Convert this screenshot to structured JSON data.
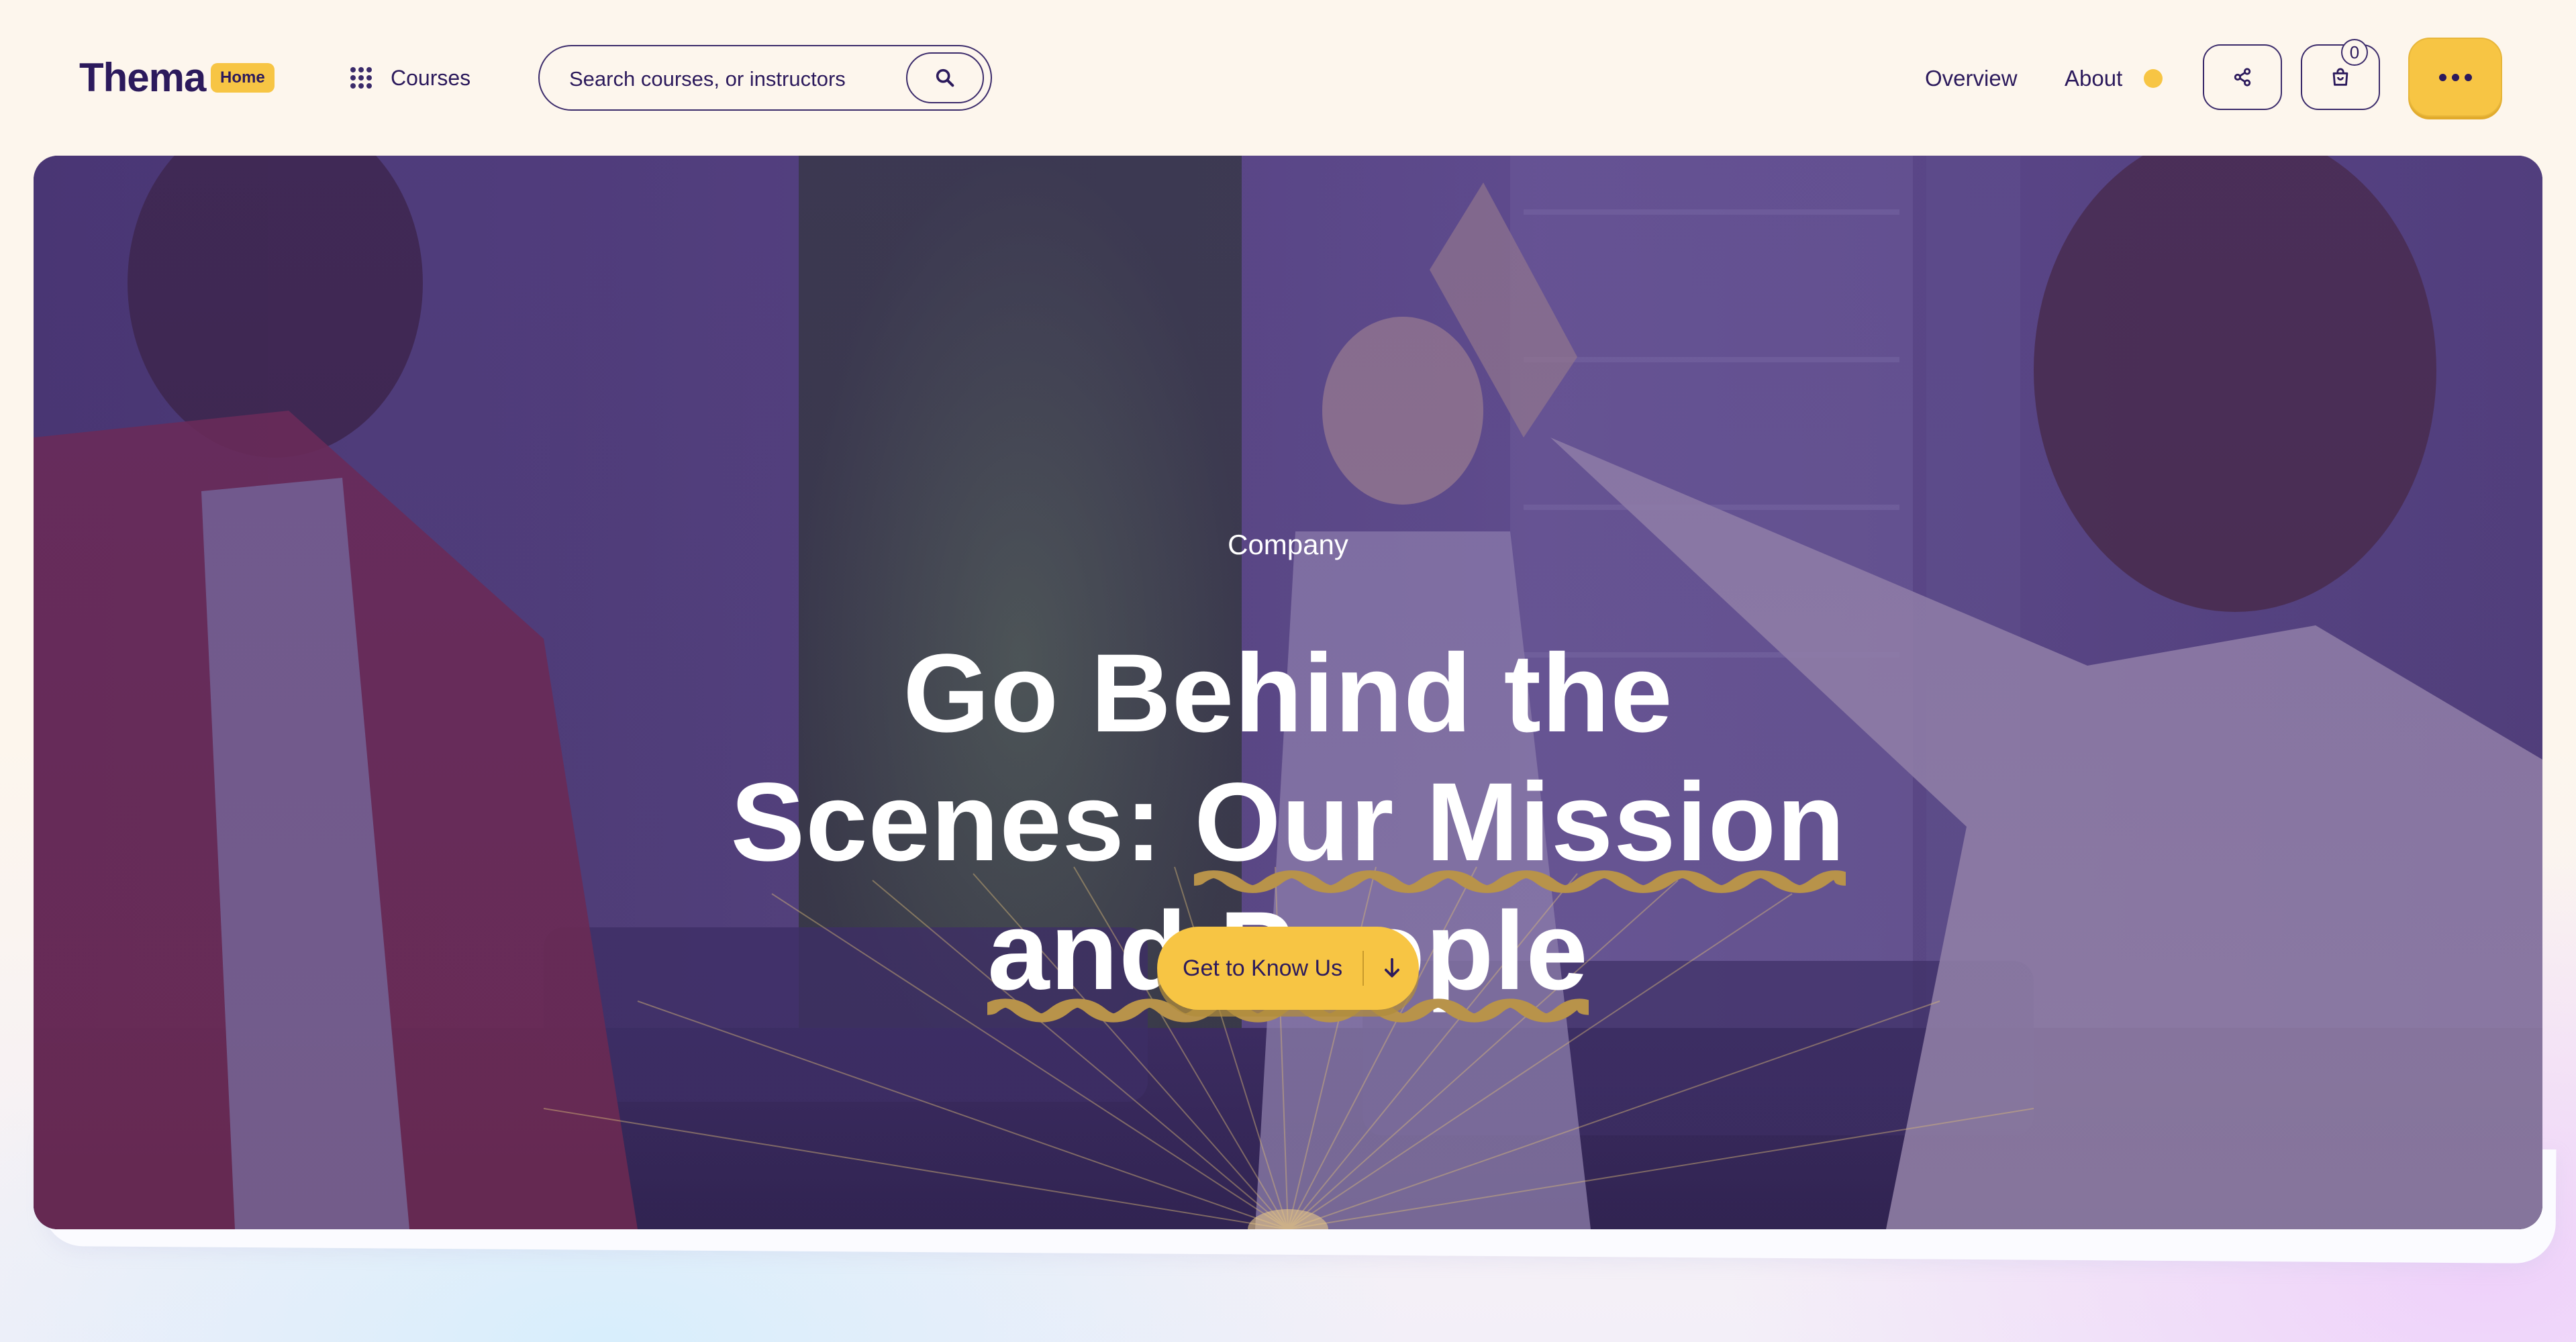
{
  "header": {
    "logo": "Thema",
    "home_badge": "Home",
    "courses_label": "Courses",
    "search": {
      "placeholder": "Search courses, or instructors",
      "value": ""
    },
    "nav": [
      {
        "label": "Overview"
      },
      {
        "label": "About"
      }
    ],
    "cart_count": "0",
    "colors": {
      "brand": "#2c1a5c",
      "accent": "#f7c544"
    },
    "icons": [
      "grid-icon",
      "search-icon",
      "share-icon",
      "shopping-bag-icon",
      "more-icon"
    ]
  },
  "hero": {
    "eyebrow": "Company",
    "title_line1": "Go Behind the",
    "title_line2_plain": "Scenes: ",
    "title_line2_highlight": "Our Mission",
    "title_line3_highlight": "and People",
    "cta_label": "Get to Know Us",
    "cta_icon": "arrow-down-icon",
    "overlay_color": "#4b3183",
    "highlight_color": "#b8934a"
  }
}
